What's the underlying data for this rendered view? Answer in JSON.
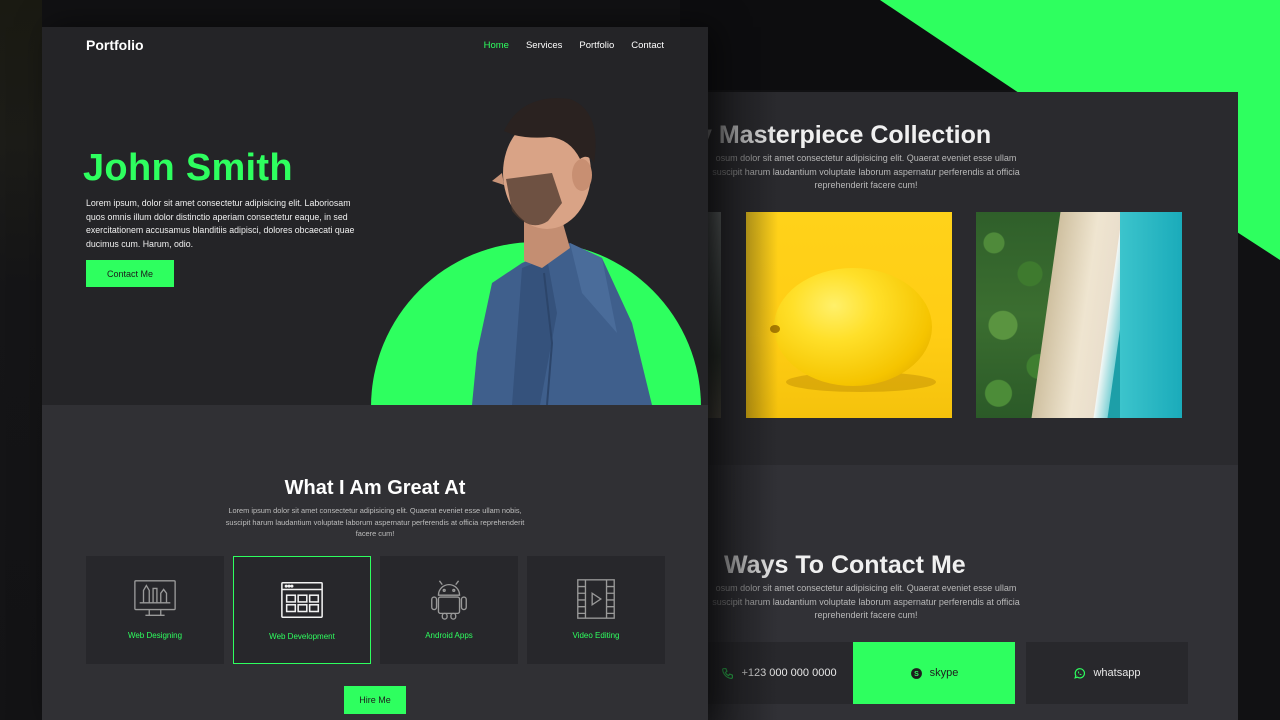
{
  "colors": {
    "accent": "#2eff5f",
    "dark_bg": "#242427",
    "panel_bg": "#303034"
  },
  "front": {
    "brand": "Portfolio",
    "nav": [
      {
        "label": "Home",
        "active": true
      },
      {
        "label": "Services",
        "active": false
      },
      {
        "label": "Portfolio",
        "active": false
      },
      {
        "label": "Contact",
        "active": false
      }
    ],
    "hero": {
      "name": "John Smith",
      "text": "Lorem ipsum, dolor sit amet consectetur adipisicing elit. Laboriosam quos omnis illum dolor distinctio aperiam consectetur eaque, in sed exercitationem accusamus blanditiis adipisci, dolores obcaecati quae ducimus cum. Harum, odio.",
      "button": "Contact Me"
    },
    "services": {
      "title": "What I Am Great At",
      "description": "Lorem ipsum dolor sit amet consectetur adipisicing elit. Quaerat eveniet esse ullam nobis, suscipit harum laudantium voluptate laborum aspernatur perferendis at officia reprehenderit facere cum!",
      "items": [
        {
          "label": "Web Designing",
          "icon": "monitor-design-icon",
          "active": false
        },
        {
          "label": "Web Development",
          "icon": "browser-window-icon",
          "active": true
        },
        {
          "label": "Android Apps",
          "icon": "android-icon",
          "active": false
        },
        {
          "label": "Video Editing",
          "icon": "film-play-icon",
          "active": false
        }
      ],
      "button": "Hire Me"
    }
  },
  "back": {
    "portfolio": {
      "title": "y Masterpiece Collection",
      "description": "osum dolor sit amet consectetur adipisicing elit. Quaerat eveniet esse ullam suscipit harum laudantium voluptate laborum aspernatur perferendis at officia reprehenderit facere cum!"
    },
    "contact": {
      "title": "Ways To Contact Me",
      "description": "osum dolor sit amet consectetur adipisicing elit. Quaerat eveniet esse ullam suscipit harum laudantium voluptate laborum aspernatur perferendis at officia reprehenderit facere cum!",
      "items": [
        {
          "label": "+123 000 000 0000",
          "icon": "phone-icon"
        },
        {
          "label": "skype",
          "icon": "skype-icon"
        },
        {
          "label": "whatsapp",
          "icon": "whatsapp-icon"
        }
      ]
    }
  }
}
